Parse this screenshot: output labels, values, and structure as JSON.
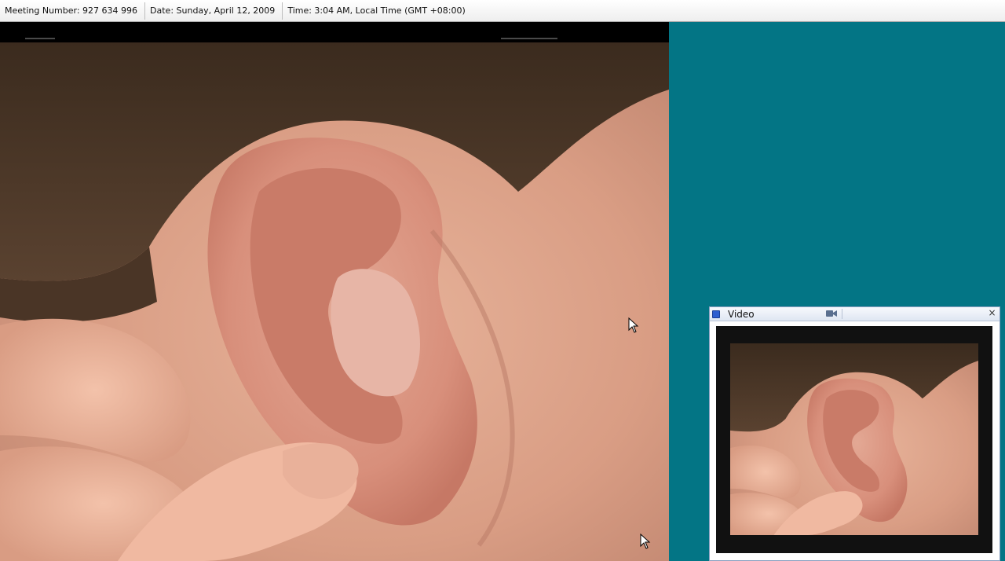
{
  "meeting_bar": {
    "meeting_number": "Meeting Number: 927 634 996",
    "date": "Date: Sunday, April 12, 2009",
    "time": "Time: 3:04 AM, Local Time (GMT +08:00)"
  },
  "share": {
    "content": "ear-closeup-video",
    "background_color": "#037585"
  },
  "video_panel": {
    "title": "Video",
    "title_icon": "camera-icon",
    "close_glyph": "×",
    "content": "ear-closeup-video-thumbnail"
  },
  "icons": [
    "panel-grip-icon",
    "camera-icon",
    "close-icon",
    "mouse-cursor-icon"
  ]
}
